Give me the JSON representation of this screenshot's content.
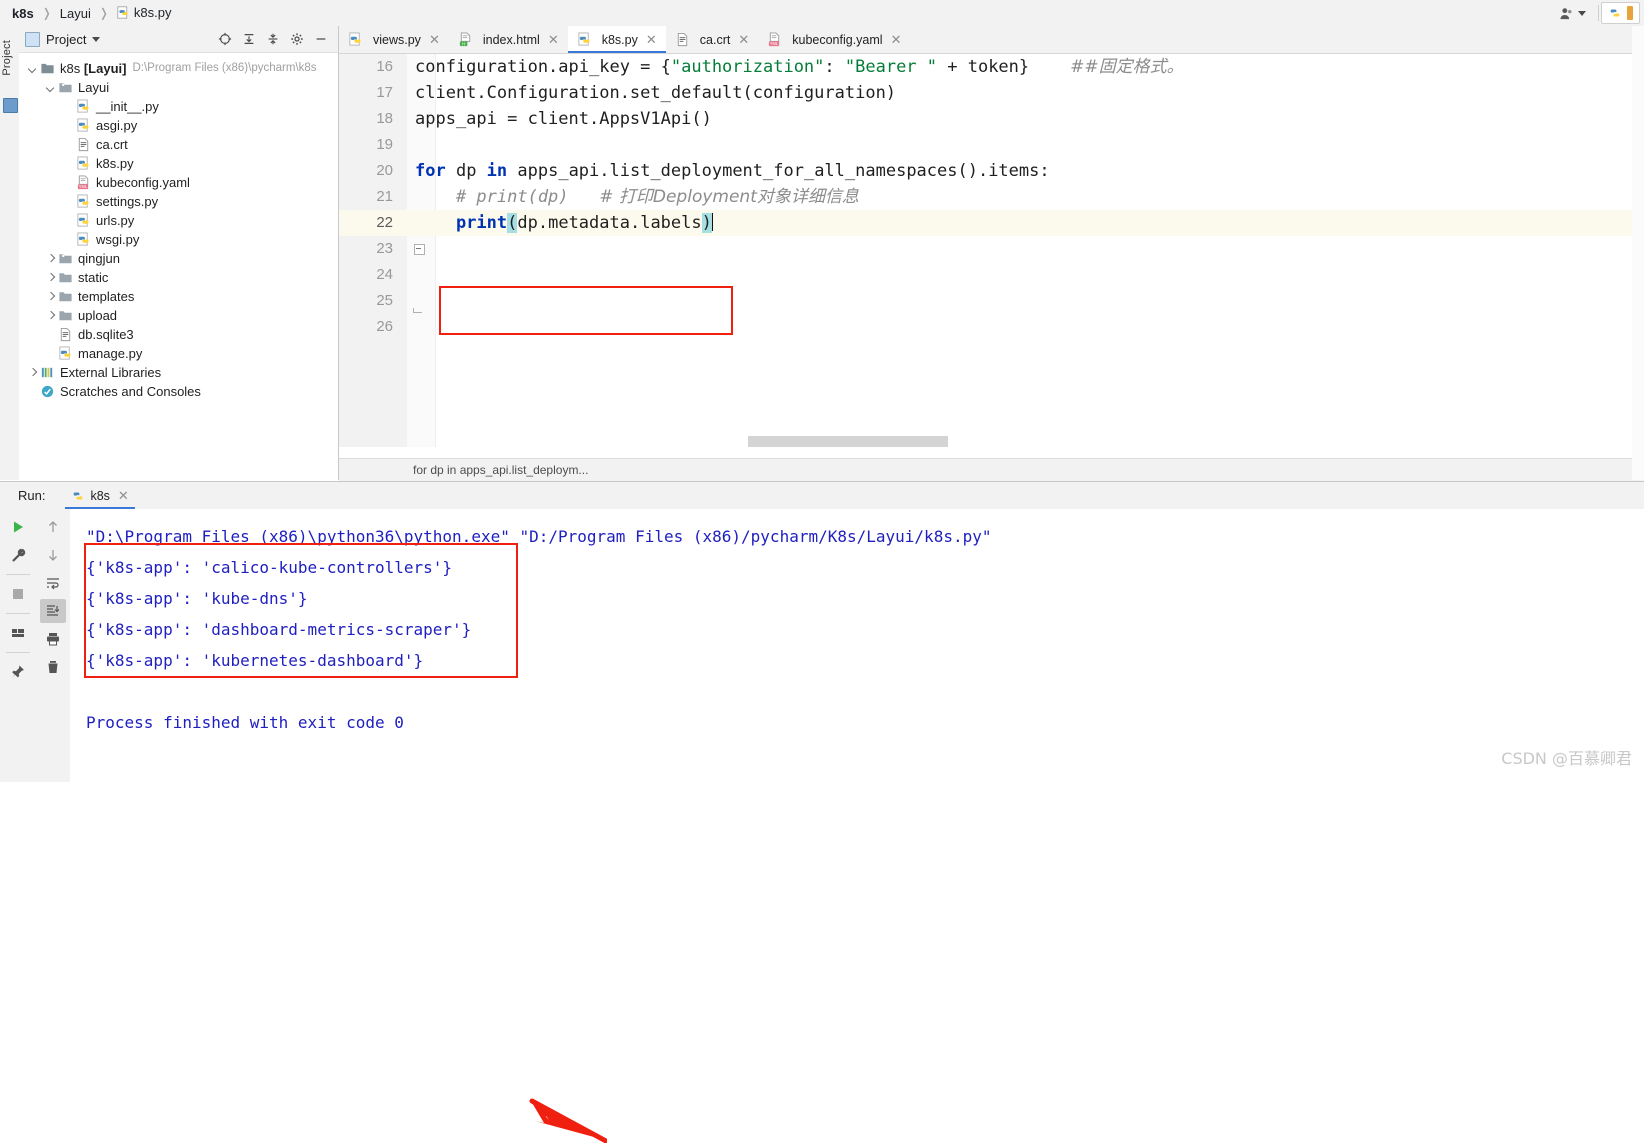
{
  "window": {
    "breadcrumb": [
      {
        "label": "k8s",
        "icon": "none",
        "bold": true
      },
      {
        "label": "Layui",
        "icon": "none",
        "bold": false
      },
      {
        "label": "k8s.py",
        "icon": "python-file-icon",
        "bold": false
      }
    ],
    "user_icon": "user-account-icon",
    "run_config_icon": "python-file-icon"
  },
  "left_strip": {
    "vertical_tab_label": "Project",
    "vertical_tab_icon": "project-icon"
  },
  "project_panel": {
    "title": "Project",
    "title_icon": "project-square-icon",
    "dropdown_icon": "chevron-down-icon",
    "header_icons": [
      "locate-target-icon",
      "expand-all-icon",
      "collapse-all-icon",
      "gear-icon",
      "hide-icon"
    ],
    "tree": [
      {
        "indent": 0,
        "arrow": "down",
        "icon": "folder-module-icon",
        "label": "k8s",
        "bold_label": "[Layui]",
        "path": "D:\\Program Files (x86)\\pycharm\\k8s"
      },
      {
        "indent": 1,
        "arrow": "down",
        "icon": "folder-package-icon",
        "label": "Layui",
        "bold_label": "",
        "path": ""
      },
      {
        "indent": 2,
        "arrow": "none",
        "icon": "python-file-icon",
        "label": "__init__.py",
        "bold_label": "",
        "path": ""
      },
      {
        "indent": 2,
        "arrow": "none",
        "icon": "python-file-icon",
        "label": "asgi.py",
        "bold_label": "",
        "path": ""
      },
      {
        "indent": 2,
        "arrow": "none",
        "icon": "text-file-icon",
        "label": "ca.crt",
        "bold_label": "",
        "path": ""
      },
      {
        "indent": 2,
        "arrow": "none",
        "icon": "python-file-icon",
        "label": "k8s.py",
        "bold_label": "",
        "path": ""
      },
      {
        "indent": 2,
        "arrow": "none",
        "icon": "yaml-file-icon",
        "label": "kubeconfig.yaml",
        "bold_label": "",
        "path": ""
      },
      {
        "indent": 2,
        "arrow": "none",
        "icon": "python-file-icon",
        "label": "settings.py",
        "bold_label": "",
        "path": ""
      },
      {
        "indent": 2,
        "arrow": "none",
        "icon": "python-file-icon",
        "label": "urls.py",
        "bold_label": "",
        "path": ""
      },
      {
        "indent": 2,
        "arrow": "none",
        "icon": "python-file-icon",
        "label": "wsgi.py",
        "bold_label": "",
        "path": ""
      },
      {
        "indent": 1,
        "arrow": "right",
        "icon": "folder-package-icon",
        "label": "qingjun",
        "bold_label": "",
        "path": ""
      },
      {
        "indent": 1,
        "arrow": "right",
        "icon": "folder-icon",
        "label": "static",
        "bold_label": "",
        "path": ""
      },
      {
        "indent": 1,
        "arrow": "right",
        "icon": "folder-icon",
        "label": "templates",
        "bold_label": "",
        "path": ""
      },
      {
        "indent": 1,
        "arrow": "right",
        "icon": "folder-icon",
        "label": "upload",
        "bold_label": "",
        "path": ""
      },
      {
        "indent": 1,
        "arrow": "none",
        "icon": "text-file-icon",
        "label": "db.sqlite3",
        "bold_label": "",
        "path": ""
      },
      {
        "indent": 1,
        "arrow": "none",
        "icon": "python-file-icon",
        "label": "manage.py",
        "bold_label": "",
        "path": ""
      },
      {
        "indent": 0,
        "arrow": "right",
        "icon": "libraries-icon",
        "label": "External Libraries",
        "bold_label": "",
        "path": ""
      },
      {
        "indent": 0,
        "arrow": "none",
        "icon": "scratches-icon",
        "label": "Scratches and Consoles",
        "bold_label": "",
        "path": ""
      }
    ]
  },
  "editor": {
    "tabs": [
      {
        "label": "views.py",
        "icon": "python-file-icon",
        "active": false,
        "close_icon": "close-icon"
      },
      {
        "label": "index.html",
        "icon": "html-file-icon",
        "active": false,
        "close_icon": "close-icon"
      },
      {
        "label": "k8s.py",
        "icon": "python-file-icon",
        "active": true,
        "close_icon": "close-icon"
      },
      {
        "label": "ca.crt",
        "icon": "text-file-icon",
        "active": false,
        "close_icon": "close-icon"
      },
      {
        "label": "kubeconfig.yaml",
        "icon": "yaml-file-icon",
        "active": false,
        "close_icon": "close-icon"
      }
    ],
    "lines": [
      {
        "num": "16",
        "segments": [
          {
            "t": "configuration.api_key = {",
            "c": "plain"
          },
          {
            "t": "\"authorization\"",
            "c": "str"
          },
          {
            "t": ": ",
            "c": "plain"
          },
          {
            "t": "\"Bearer \"",
            "c": "str"
          },
          {
            "t": " + token}",
            "c": "plain"
          },
          {
            "t": "    ",
            "c": "plain"
          },
          {
            "t": "##固定格式。",
            "c": "cmt-cjk"
          }
        ]
      },
      {
        "num": "17",
        "segments": [
          {
            "t": "client.Configuration.set_default(configuration)",
            "c": "plain"
          }
        ]
      },
      {
        "num": "18",
        "segments": [
          {
            "t": "apps_api = client.AppsV1Api()",
            "c": "plain"
          }
        ]
      },
      {
        "num": "19",
        "segments": [
          {
            "t": "",
            "c": "plain"
          }
        ]
      },
      {
        "num": "20",
        "segments": [
          {
            "t": "for",
            "c": "k"
          },
          {
            "t": " dp ",
            "c": "plain"
          },
          {
            "t": "in",
            "c": "k"
          },
          {
            "t": " apps_api.list_deployment_for_all_namespaces().items:",
            "c": "plain"
          }
        ]
      },
      {
        "num": "21",
        "segments": [
          {
            "t": "    # print(dp)   ",
            "c": "cmt"
          },
          {
            "t": "# 打印Deployment对象详细信息",
            "c": "cmt-cjk"
          }
        ]
      },
      {
        "num": "22",
        "segments": [
          {
            "t": "    ",
            "c": "plain"
          },
          {
            "t": "print",
            "c": "k"
          },
          {
            "t": "(",
            "c": "sel"
          },
          {
            "t": "dp.metadata.labels",
            "c": "plain"
          },
          {
            "t": ")",
            "c": "sel"
          }
        ]
      },
      {
        "num": "23",
        "segments": [
          {
            "t": "",
            "c": "plain"
          }
        ]
      },
      {
        "num": "24",
        "segments": [
          {
            "t": "",
            "c": "plain"
          }
        ]
      },
      {
        "num": "25",
        "segments": [
          {
            "t": "",
            "c": "plain"
          }
        ]
      },
      {
        "num": "26",
        "segments": [
          {
            "t": "",
            "c": "plain"
          }
        ]
      }
    ],
    "status_breadcrumb": "for dp in apps_api.list_deploym...",
    "highlight_color": "#f02010"
  },
  "run_panel": {
    "label": "Run:",
    "tab_label": "k8s",
    "tab_icon": "python-file-icon",
    "tab_close_icon": "close-icon",
    "tools_left": [
      {
        "name": "rerun-icon",
        "selected": false
      },
      {
        "name": "wrench-settings-icon",
        "selected": false
      },
      {
        "name": "stop-icon",
        "selected": false
      },
      {
        "name": "layout-icon",
        "selected": false
      },
      {
        "name": "pin-icon",
        "selected": false
      }
    ],
    "tools_right": [
      {
        "name": "arrow-up-icon",
        "selected": false
      },
      {
        "name": "arrow-down-icon",
        "selected": false
      },
      {
        "name": "soft-wrap-icon",
        "selected": false
      },
      {
        "name": "scroll-to-end-icon",
        "selected": true
      },
      {
        "name": "print-icon",
        "selected": false
      },
      {
        "name": "trash-icon",
        "selected": false
      }
    ],
    "console": [
      {
        "text": "\"D:\\Program Files (x86)\\python36\\python.exe\" \"D:/Program Files (x86)/pycharm/K8s/Layui/k8s.py\"",
        "color": "blue"
      },
      {
        "text": "{'k8s-app': 'calico-kube-controllers'}",
        "color": "blue"
      },
      {
        "text": "{'k8s-app': 'kube-dns'}",
        "color": "blue"
      },
      {
        "text": "{'k8s-app': 'dashboard-metrics-scraper'}",
        "color": "blue"
      },
      {
        "text": "{'k8s-app': 'kubernetes-dashboard'}",
        "color": "blue"
      },
      {
        "text": "",
        "color": "blue"
      },
      {
        "text": "Process finished with exit code 0",
        "color": "blue"
      }
    ]
  },
  "watermark": "CSDN @百慕卿君"
}
